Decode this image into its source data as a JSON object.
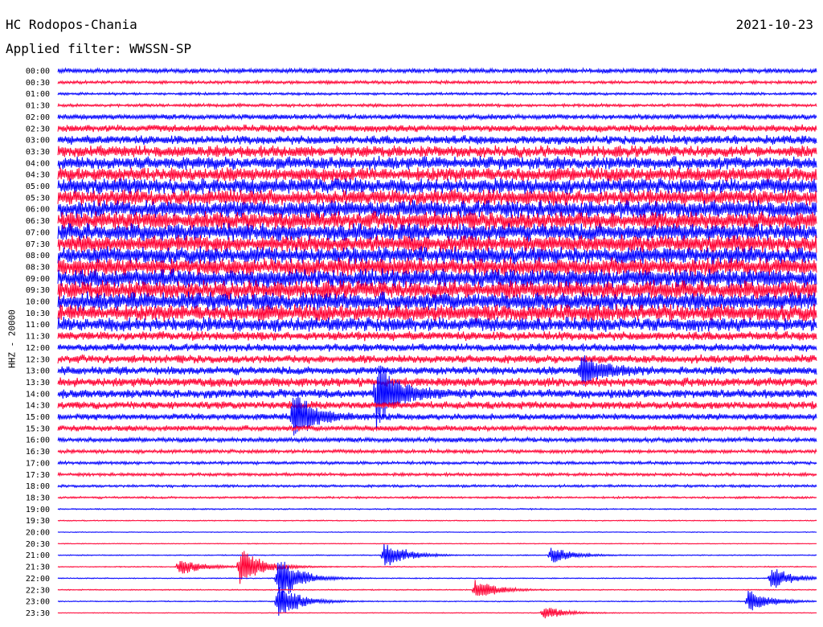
{
  "header": {
    "station": "HC Rodopos-Chania",
    "date": "2021-10-23",
    "filter": "Applied filter: WWSSN-SP"
  },
  "axis_label": "HHZ - 20000",
  "colors": {
    "even_row": "#0000ff",
    "odd_row": "#ff0033",
    "background": "#ffffff"
  },
  "chart_data": {
    "type": "line",
    "title": "HC Rodopos-Chania",
    "subtitle": "Applied filter: WWSSN-SP",
    "ylabel": "HHZ - 20000",
    "rows": [
      "00:00",
      "00:30",
      "01:00",
      "01:30",
      "02:00",
      "02:30",
      "03:00",
      "03:30",
      "04:00",
      "04:30",
      "05:00",
      "05:30",
      "06:00",
      "06:30",
      "07:00",
      "07:30",
      "08:00",
      "08:30",
      "09:00",
      "09:30",
      "10:00",
      "10:30",
      "11:00",
      "11:30",
      "12:00",
      "12:30",
      "13:00",
      "13:30",
      "14:00",
      "14:30",
      "15:00",
      "15:30",
      "16:00",
      "16:30",
      "17:00",
      "17:30",
      "18:00",
      "18:30",
      "19:00",
      "19:30",
      "20:00",
      "20:30",
      "21:00",
      "21:30",
      "22:00",
      "22:30",
      "23:00",
      "23:30"
    ],
    "noise_level": [
      0.18,
      0.12,
      0.1,
      0.12,
      0.2,
      0.28,
      0.35,
      0.45,
      0.5,
      0.55,
      0.6,
      0.62,
      0.68,
      0.7,
      0.68,
      0.66,
      0.66,
      0.7,
      0.72,
      0.72,
      0.7,
      0.65,
      0.55,
      0.35,
      0.3,
      0.32,
      0.32,
      0.35,
      0.35,
      0.3,
      0.25,
      0.22,
      0.18,
      0.14,
      0.12,
      0.12,
      0.1,
      0.08,
      0.05,
      0.04,
      0.03,
      0.03,
      0.04,
      0.04,
      0.04,
      0.04,
      0.04,
      0.03
    ],
    "events": [
      {
        "row": 30,
        "x": 0.31,
        "amplitude": 2.8
      },
      {
        "row": 28,
        "x": 0.42,
        "amplitude": 3.5
      },
      {
        "row": 26,
        "x": 0.69,
        "amplitude": 1.8
      },
      {
        "row": 42,
        "x": 0.43,
        "amplitude": 1.5
      },
      {
        "row": 43,
        "x": 0.24,
        "amplitude": 2.2
      },
      {
        "row": 44,
        "x": 0.29,
        "amplitude": 2.5
      },
      {
        "row": 46,
        "x": 0.29,
        "amplitude": 2.0
      },
      {
        "row": 44,
        "x": 0.94,
        "amplitude": 1.2
      },
      {
        "row": 46,
        "x": 0.91,
        "amplitude": 1.3
      },
      {
        "row": 45,
        "x": 0.55,
        "amplitude": 1.1
      },
      {
        "row": 42,
        "x": 0.65,
        "amplitude": 0.9
      },
      {
        "row": 43,
        "x": 0.16,
        "amplitude": 1.0
      },
      {
        "row": 47,
        "x": 0.64,
        "amplitude": 0.7
      }
    ]
  }
}
